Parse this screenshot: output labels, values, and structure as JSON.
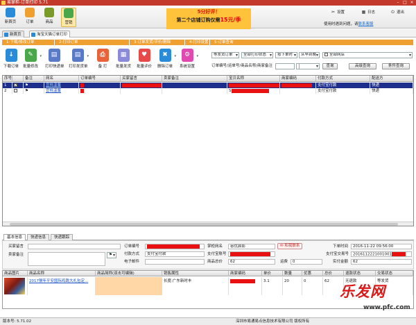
{
  "app": {
    "title": "易掌柜-订单打印 5.71"
  },
  "nav": [
    {
      "label": "新首页",
      "color": "#2a8bd8"
    },
    {
      "label": "订单",
      "color": "#f0a030"
    },
    {
      "label": "商品",
      "color": "#7a9a2a"
    },
    {
      "label": "营销",
      "color": "#4aa84a"
    }
  ],
  "promo": {
    "line1": "5分好评！",
    "line2_pre": "第二个店铺订购仅需",
    "line2_price": "15元/季"
  },
  "topright": {
    "settings": "设置",
    "log": "日志",
    "exit": "退出",
    "help_text": "使用时遇到问题，请",
    "help_link": "联系客服"
  },
  "tabs": [
    {
      "label": "新首页"
    },
    {
      "label": "淘宝天猫订单打印"
    }
  ],
  "steps": [
    {
      "label": "1-下载/修改订单",
      "w": 76
    },
    {
      "label": "2-打印订单",
      "w": 108
    },
    {
      "label": "3-订单发货/评价/删除",
      "w": 80
    },
    {
      "label": "4-打印设置",
      "w": 36
    },
    {
      "label": "5-订单查询",
      "w": 294
    }
  ],
  "toolbar": [
    {
      "label": "下载订单",
      "color": "#2a8bd8",
      "glyph": "↓"
    },
    {
      "label": "批量修改",
      "color": "#4aa84a",
      "glyph": "✎"
    },
    {
      "label": "打印快递单",
      "color": "#5a7ac8",
      "glyph": "▤"
    },
    {
      "label": "打印发货单",
      "color": "#5a7ac8",
      "glyph": "▤"
    },
    {
      "label": "备  打",
      "color": "#e8623a",
      "glyph": "⎙"
    },
    {
      "label": "批量发货",
      "color": "#8a8ad8",
      "glyph": "▦"
    },
    {
      "label": "批量评价",
      "color": "#e84a4a",
      "glyph": "♥"
    },
    {
      "label": "删除订单",
      "color": "#2a8bd8",
      "glyph": "✖"
    },
    {
      "label": "系统设置",
      "color": "#e04ab0",
      "glyph": "⚙"
    }
  ],
  "filters": {
    "order_status": "等发货订单",
    "print_status": "全部打印状态",
    "sort1": "按下单时",
    "sort2": "从早到晚",
    "shop": "全部网店",
    "search_label": "订单编号/运单号/商品名称/商家备注",
    "query": "查询",
    "advanced": "高级查询",
    "cond_query": "条件查询"
  },
  "grid": {
    "columns": [
      "序号",
      "",
      "备注",
      "网名",
      "订单编号",
      "买家留言",
      "卖家备注",
      "宝贝名称",
      "商家编码",
      "付款方式",
      "配送方"
    ],
    "rows": [
      {
        "no": "1",
        "checked": true,
        "buyer": "宜桃温馨",
        "pay": "支付宝付款",
        "ship": "快递",
        "seller_note": "",
        "item": ""
      },
      {
        "no": "2",
        "checked": false,
        "buyer": "宜桃温馨",
        "pay": "支付宝付款",
        "ship": "快递",
        "seller_note": "",
        "item": "S"
      }
    ]
  },
  "btabs": [
    "基本信息",
    "快递信息",
    "快递跟踪"
  ],
  "detail": {
    "buyer_msg_label": "买家留言",
    "seller_note_label": "卖家备注",
    "order_no_label": "订单编号",
    "pay_method_label": "付款方式",
    "pay_method": "支付宝付款",
    "email_label": "电子邮件",
    "shop_name_label": "掌柜网名",
    "shop_name": "容优启影",
    "alipay_label": "支付宝账号",
    "goods_total_label": "商品总价",
    "goods_total": "62",
    "shipping_label": "运费",
    "shipping": "0",
    "contact": "和我联系",
    "order_time_label": "下单时间",
    "order_time": "2016-11-22 09:56:00",
    "alipay_trade_label": "支付宝交易号",
    "alipay_trade": "2016112221001001",
    "paid_label": "实付金额",
    "paid": "62"
  },
  "products": {
    "columns": [
      "商品图片",
      "商品名称",
      "商品简称(双击可编辑)",
      "销售属性",
      "商家编码",
      "单价",
      "数量",
      "优惠",
      "总价",
      "退款状态",
      "交易状态"
    ],
    "row": {
      "name": "2017猴年平安国际鸡跳大礼包定...",
      "attr": "长度:广东新时丰",
      "price": "3.1",
      "qty": "20",
      "discount": "0",
      "total": "62",
      "refund": "无退款",
      "status": "等发货"
    }
  },
  "status": {
    "version": "版本号: 5.71.02",
    "company": "深圳市易通易点信息技术有限公司 版权所有"
  },
  "watermark": {
    "brand": "乐发网",
    "url": "www.pfc.com"
  }
}
